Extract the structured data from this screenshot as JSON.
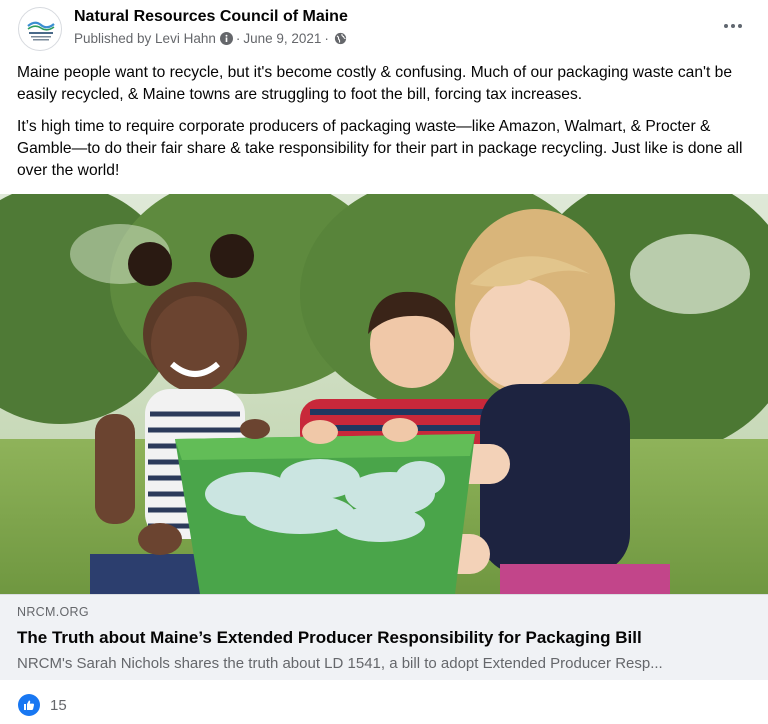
{
  "post": {
    "page_name": "Natural Resources Council of Maine",
    "published_by": "Published by Levi Hahn",
    "date": "June 9, 2021",
    "separator": "·",
    "paragraphs": [
      "Maine people want to recycle, but it's become costly & confusing. Much of our packaging waste can't be easily recycled, & Maine towns are struggling to foot the bill, forcing tax increases.",
      "It’s high time to require corporate producers of packaging waste—like Amazon, Walmart, & Procter & Gamble—to do their fair share & take responsibility for their part in package recycling. Just like is done all over the world!"
    ]
  },
  "link_preview": {
    "domain": "NRCM.ORG",
    "title": "The Truth about Maine’s Extended Producer Responsibility for Packaging Bill",
    "description": "NRCM's Sarah Nichols shares the truth about LD 1541, a bill to adopt Extended Producer Resp..."
  },
  "reactions": {
    "count": "15",
    "icon": "like-icon"
  },
  "colors": {
    "accent": "#1877f2",
    "secondary_text": "#65676b",
    "link_bg": "#f0f2f5"
  }
}
